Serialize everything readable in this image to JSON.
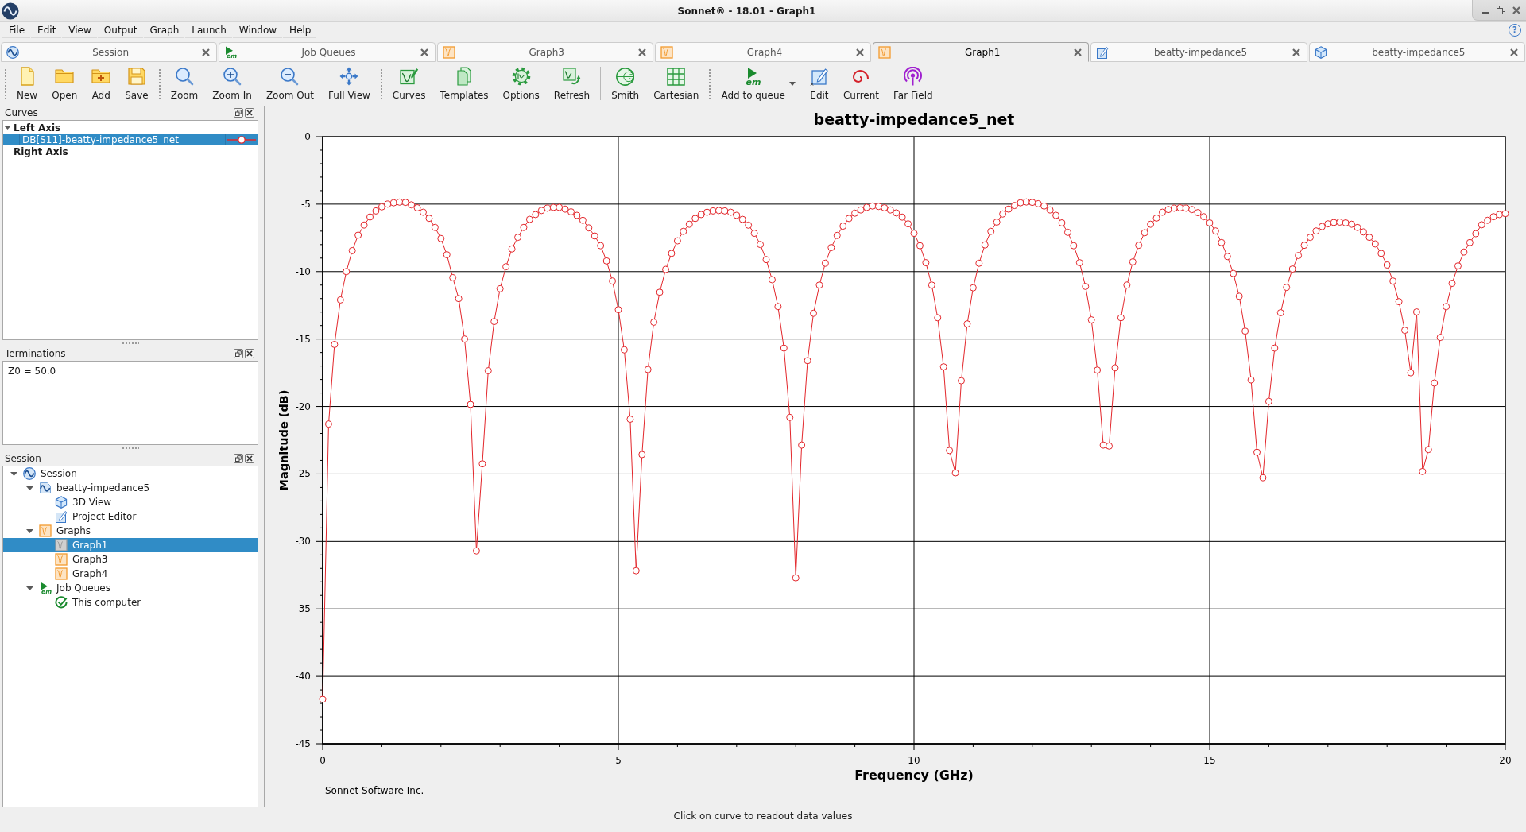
{
  "window": {
    "title": "Sonnet® - 18.01 - Graph1"
  },
  "menu_bar": {
    "items": [
      "File",
      "Edit",
      "View",
      "Output",
      "Graph",
      "Launch",
      "Window",
      "Help"
    ],
    "help": "?"
  },
  "tabs": [
    {
      "label": "Session",
      "kind": "session",
      "selected": false
    },
    {
      "label": "Job Queues",
      "kind": "queue",
      "icon_text": "em",
      "selected": false
    },
    {
      "label": "Graph3",
      "kind": "graph",
      "selected": false
    },
    {
      "label": "Graph4",
      "kind": "graph",
      "selected": false
    },
    {
      "label": "Graph1",
      "kind": "graph",
      "selected": true
    },
    {
      "label": "beatty-impedance5",
      "kind": "editor",
      "selected": false
    },
    {
      "label": "beatty-impedance5",
      "kind": "model",
      "selected": false
    }
  ],
  "toolbars": [
    [
      [
        {
          "label": "New",
          "kind": "new",
          "dropdown": false
        },
        {
          "label": "Open",
          "kind": "open",
          "dropdown": false
        },
        {
          "label": "Add",
          "kind": "add",
          "dropdown": false
        },
        {
          "label": "Save",
          "kind": "save",
          "dropdown": false
        }
      ]
    ],
    [
      [
        {
          "label": "Zoom",
          "kind": "zoom",
          "dropdown": false
        },
        {
          "label": "Zoom In",
          "kind": "zoomin",
          "dropdown": false
        },
        {
          "label": "Zoom Out",
          "kind": "zoomout",
          "dropdown": false
        },
        {
          "label": "Full View",
          "kind": "fullview",
          "dropdown": false
        }
      ]
    ],
    [
      [
        {
          "label": "Curves",
          "kind": "curves",
          "dropdown": false
        },
        {
          "label": "Templates",
          "kind": "templates",
          "dropdown": false
        },
        {
          "label": "Options",
          "kind": "options",
          "dropdown": false
        },
        {
          "label": "Refresh",
          "kind": "refresh",
          "dropdown": false
        }
      ],
      [
        {
          "label": "Smith",
          "kind": "smith",
          "dropdown": false
        },
        {
          "label": "Cartesian",
          "kind": "cartesian",
          "dropdown": false
        }
      ]
    ],
    [
      [
        {
          "label": "Add to queue",
          "kind": "queue",
          "icon_text": "em",
          "dropdown": true
        },
        {
          "label": "Edit",
          "kind": "edit",
          "dropdown": false
        },
        {
          "label": "Current",
          "kind": "current",
          "dropdown": false
        },
        {
          "label": "Far Field",
          "kind": "farfield",
          "dropdown": false
        }
      ]
    ]
  ],
  "curves_panel": {
    "title": "Curves",
    "tree": [
      {
        "label": "Left Axis",
        "kind": "axis",
        "expanded": true,
        "selected": false,
        "children": [
          {
            "label": "DB[S11]-beatty-impedance5_net",
            "kind": "curve",
            "selected": true
          }
        ]
      },
      {
        "label": "Right Axis",
        "kind": "axis",
        "selected": false
      }
    ]
  },
  "terminations_panel": {
    "title": "Terminations",
    "text": "Z0 = 50.0"
  },
  "session_panel": {
    "title": "Session",
    "tree": [
      {
        "label": "Session",
        "kind": "session",
        "expanded": true,
        "selected": false,
        "children": [
          {
            "label": "beatty-impedance5",
            "kind": "project",
            "expanded": true,
            "selected": false,
            "children": [
              {
                "label": "3D View",
                "kind": "model",
                "selected": false
              },
              {
                "label": "Project Editor",
                "kind": "editor",
                "selected": false
              }
            ]
          },
          {
            "label": "Graphs",
            "kind": "graphs",
            "expanded": true,
            "selected": false,
            "children": [
              {
                "label": "Graph1",
                "kind": "graph",
                "selected": true
              },
              {
                "label": "Graph3",
                "kind": "graph",
                "selected": false
              },
              {
                "label": "Graph4",
                "kind": "graph",
                "selected": false
              }
            ]
          },
          {
            "label": "Job Queues",
            "kind": "queue",
            "icon_text": "em",
            "expanded": true,
            "selected": false,
            "children": [
              {
                "label": "This computer",
                "kind": "computer",
                "selected": false
              }
            ]
          }
        ]
      }
    ]
  },
  "graph": {
    "chart_data": {
      "type": "line",
      "title": "beatty-impedance5_net",
      "xlabel": "Frequency (GHz)",
      "ylabel": "Magnitude (dB)",
      "grid": true,
      "x": [
        0,
        0.1,
        0.2,
        0.3,
        0.4,
        0.5,
        0.6,
        0.7,
        0.8,
        0.9,
        1,
        1.1,
        1.2,
        1.3,
        1.4,
        1.5,
        1.6,
        1.7,
        1.8,
        1.9,
        2,
        2.1,
        2.2,
        2.3,
        2.4,
        2.5,
        2.6,
        2.7,
        2.8,
        2.9,
        3,
        3.1,
        3.2,
        3.3,
        3.4,
        3.5,
        3.6,
        3.7,
        3.8,
        3.9,
        4,
        4.1,
        4.2,
        4.3,
        4.4,
        4.5,
        4.6,
        4.7,
        4.8,
        4.9,
        5,
        5.1,
        5.2,
        5.3,
        5.4,
        5.5,
        5.6,
        5.7,
        5.8,
        5.9,
        6,
        6.1,
        6.2,
        6.3,
        6.4,
        6.5,
        6.6,
        6.7,
        6.8,
        6.9,
        7,
        7.1,
        7.2,
        7.3,
        7.4,
        7.5,
        7.6,
        7.7,
        7.8,
        7.9,
        8,
        8.1,
        8.2,
        8.3,
        8.4,
        8.5,
        8.6,
        8.7,
        8.8,
        8.9,
        9,
        9.1,
        9.2,
        9.3,
        9.4,
        9.5,
        9.6,
        9.7,
        9.8,
        9.9,
        10,
        10.1,
        10.2,
        10.3,
        10.4,
        10.5,
        10.6,
        10.7,
        10.8,
        10.9,
        11,
        11.1,
        11.2,
        11.3,
        11.4,
        11.5,
        11.6,
        11.7,
        11.8,
        11.9,
        12,
        12.1,
        12.2,
        12.3,
        12.4,
        12.5,
        12.6,
        12.7,
        12.8,
        12.9,
        13,
        13.1,
        13.2,
        13.3,
        13.4,
        13.5,
        13.6,
        13.7,
        13.8,
        13.9,
        14,
        14.1,
        14.2,
        14.3,
        14.4,
        14.5,
        14.6,
        14.7,
        14.8,
        14.9,
        15,
        15.1,
        15.2,
        15.3,
        15.4,
        15.5,
        15.6,
        15.7,
        15.8,
        15.9,
        16,
        16.1,
        16.2,
        16.3,
        16.4,
        16.5,
        16.6,
        16.7,
        16.8,
        16.9,
        17,
        17.1,
        17.2,
        17.3,
        17.4,
        17.5,
        17.6,
        17.7,
        17.8,
        17.9,
        18,
        18.1,
        18.2,
        18.3,
        18.4,
        18.5,
        18.6,
        18.7,
        18.8,
        18.9,
        19,
        19.1,
        19.2,
        19.3,
        19.4,
        19.5,
        19.6,
        19.7,
        19.8,
        19.9,
        20
      ],
      "series": [
        {
          "color": "#e3262b",
          "marker": "circle",
          "values": [
            -41.7,
            -21.3,
            -15.4,
            -12.1,
            -10.0,
            -8.45,
            -7.3,
            -6.55,
            -5.95,
            -5.5,
            -5.2,
            -5.0,
            -4.9,
            -4.85,
            -4.87,
            -5.05,
            -5.27,
            -5.6,
            -6.05,
            -6.73,
            -7.55,
            -8.75,
            -10.45,
            -12.0,
            -15.0,
            -19.85,
            -30.7,
            -24.25,
            -17.35,
            -13.7,
            -11.27,
            -9.64,
            -8.32,
            -7.46,
            -6.73,
            -6.13,
            -5.77,
            -5.47,
            -5.3,
            -5.24,
            -5.24,
            -5.37,
            -5.57,
            -5.83,
            -6.2,
            -6.76,
            -7.36,
            -8.08,
            -9.21,
            -10.7,
            -12.82,
            -15.8,
            -20.94,
            -32.17,
            -23.56,
            -17.26,
            -13.75,
            -11.53,
            -9.84,
            -8.65,
            -7.72,
            -7.02,
            -6.49,
            -6.06,
            -5.77,
            -5.6,
            -5.5,
            -5.47,
            -5.5,
            -5.6,
            -5.83,
            -6.13,
            -6.56,
            -7.16,
            -7.99,
            -9.11,
            -10.6,
            -12.59,
            -15.67,
            -20.81,
            -32.7,
            -22.86,
            -16.6,
            -13.09,
            -11.0,
            -9.38,
            -8.22,
            -7.32,
            -6.63,
            -6.06,
            -5.67,
            -5.43,
            -5.24,
            -5.14,
            -5.17,
            -5.27,
            -5.43,
            -5.65,
            -5.96,
            -6.46,
            -7.16,
            -8.08,
            -9.34,
            -11.0,
            -13.42,
            -17.06,
            -23.26,
            -24.92,
            -18.09,
            -13.88,
            -11.2,
            -9.38,
            -8.02,
            -7.02,
            -6.33,
            -5.73,
            -5.37,
            -5.1,
            -4.9,
            -4.84,
            -4.87,
            -4.97,
            -5.14,
            -5.43,
            -5.83,
            -6.39,
            -7.09,
            -8.08,
            -9.34,
            -11.1,
            -13.58,
            -17.3,
            -22.86,
            -22.93,
            -17.13,
            -13.42,
            -11.0,
            -9.28,
            -8.05,
            -7.12,
            -6.49,
            -6.03,
            -5.6,
            -5.4,
            -5.3,
            -5.27,
            -5.3,
            -5.4,
            -5.63,
            -5.93,
            -6.39,
            -6.99,
            -7.85,
            -8.88,
            -10.14,
            -11.83,
            -14.41,
            -18.03,
            -23.39,
            -25.28,
            -19.62,
            -15.67,
            -13.05,
            -11.17,
            -9.81,
            -8.81,
            -8.05,
            -7.46,
            -6.99,
            -6.66,
            -6.46,
            -6.36,
            -6.33,
            -6.39,
            -6.49,
            -6.73,
            -7.06,
            -7.46,
            -7.95,
            -8.65,
            -9.51,
            -10.7,
            -12.23,
            -14.35,
            -17.5,
            -12.99,
            -24.82,
            -23.19,
            -18.26,
            -14.88,
            -12.59,
            -10.87,
            -9.58,
            -8.55,
            -7.85,
            -7.19,
            -6.53,
            -6.2,
            -5.93,
            -5.77,
            -5.7
          ]
        }
      ],
      "xlim": [
        0,
        20
      ],
      "ylim": [
        -45,
        0
      ],
      "xticks": [
        0,
        5,
        10,
        15,
        20
      ],
      "yticks": [
        0,
        -5,
        -10,
        -15,
        -20,
        -25,
        -30,
        -35,
        -40,
        -45
      ]
    },
    "credit": "Sonnet Software Inc."
  },
  "status_bar": {
    "text": "Click on curve to readout data values"
  }
}
